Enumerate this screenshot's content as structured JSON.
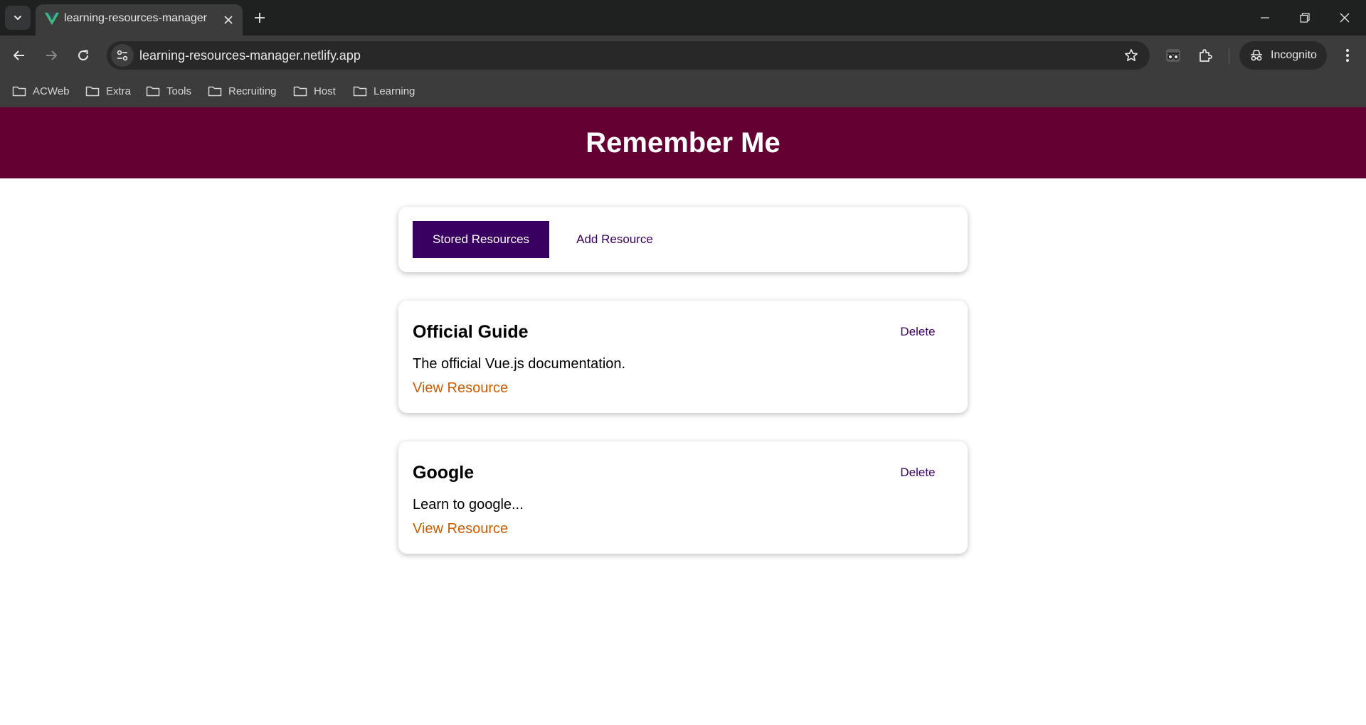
{
  "browser": {
    "tab": {
      "title": "learning-resources-manager"
    },
    "omnibox": {
      "url": "learning-resources-manager.netlify.app"
    },
    "incognito_label": "Incognito",
    "bookmarks": [
      {
        "label": "ACWeb"
      },
      {
        "label": "Extra"
      },
      {
        "label": "Tools"
      },
      {
        "label": "Recruiting"
      },
      {
        "label": "Host"
      },
      {
        "label": "Learning"
      }
    ],
    "colors": {
      "frame": "#1f2020",
      "toolbar": "#3c3c3c",
      "omnibox": "#282828",
      "favicon": "#41b883"
    }
  },
  "app": {
    "title": "Remember Me",
    "nav": {
      "stored_label": "Stored Resources",
      "add_label": "Add Resource"
    },
    "resources": [
      {
        "title": "Official Guide",
        "description": "The official Vue.js documentation.",
        "link_label": "View Resource",
        "delete_label": "Delete"
      },
      {
        "title": "Google",
        "description": "Learn to google...",
        "link_label": "View Resource",
        "delete_label": "Delete"
      }
    ],
    "colors": {
      "header": "#640032",
      "primary": "#3a0061",
      "link": "#ce5c00"
    }
  }
}
